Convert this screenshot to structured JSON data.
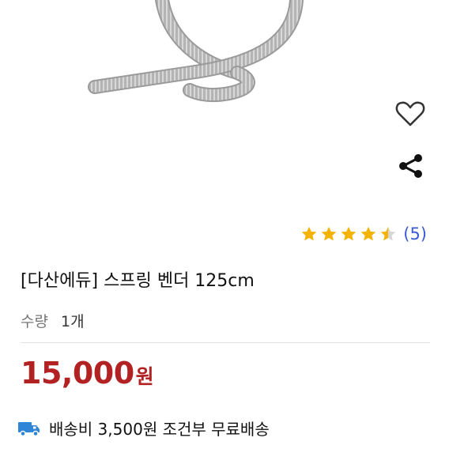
{
  "product": {
    "title": "[다산에듀] 스프링 벤더 125cm",
    "rating_count": "(5)",
    "rating": 4.5,
    "quantity_label": "수량",
    "quantity_value": "1개",
    "price_amount": "15,000",
    "price_unit": "원",
    "shipping_text": "배송비 3,500원 조건부 무료배송"
  },
  "icons": {
    "wish": "heart-icon",
    "share": "share-icon",
    "shipping": "truck-icon",
    "star": "star-icon"
  },
  "colors": {
    "price": "#b32222",
    "star": "#f5b301",
    "rating_count": "#3b5bd6",
    "shipping_icon": "#2f86d6"
  }
}
